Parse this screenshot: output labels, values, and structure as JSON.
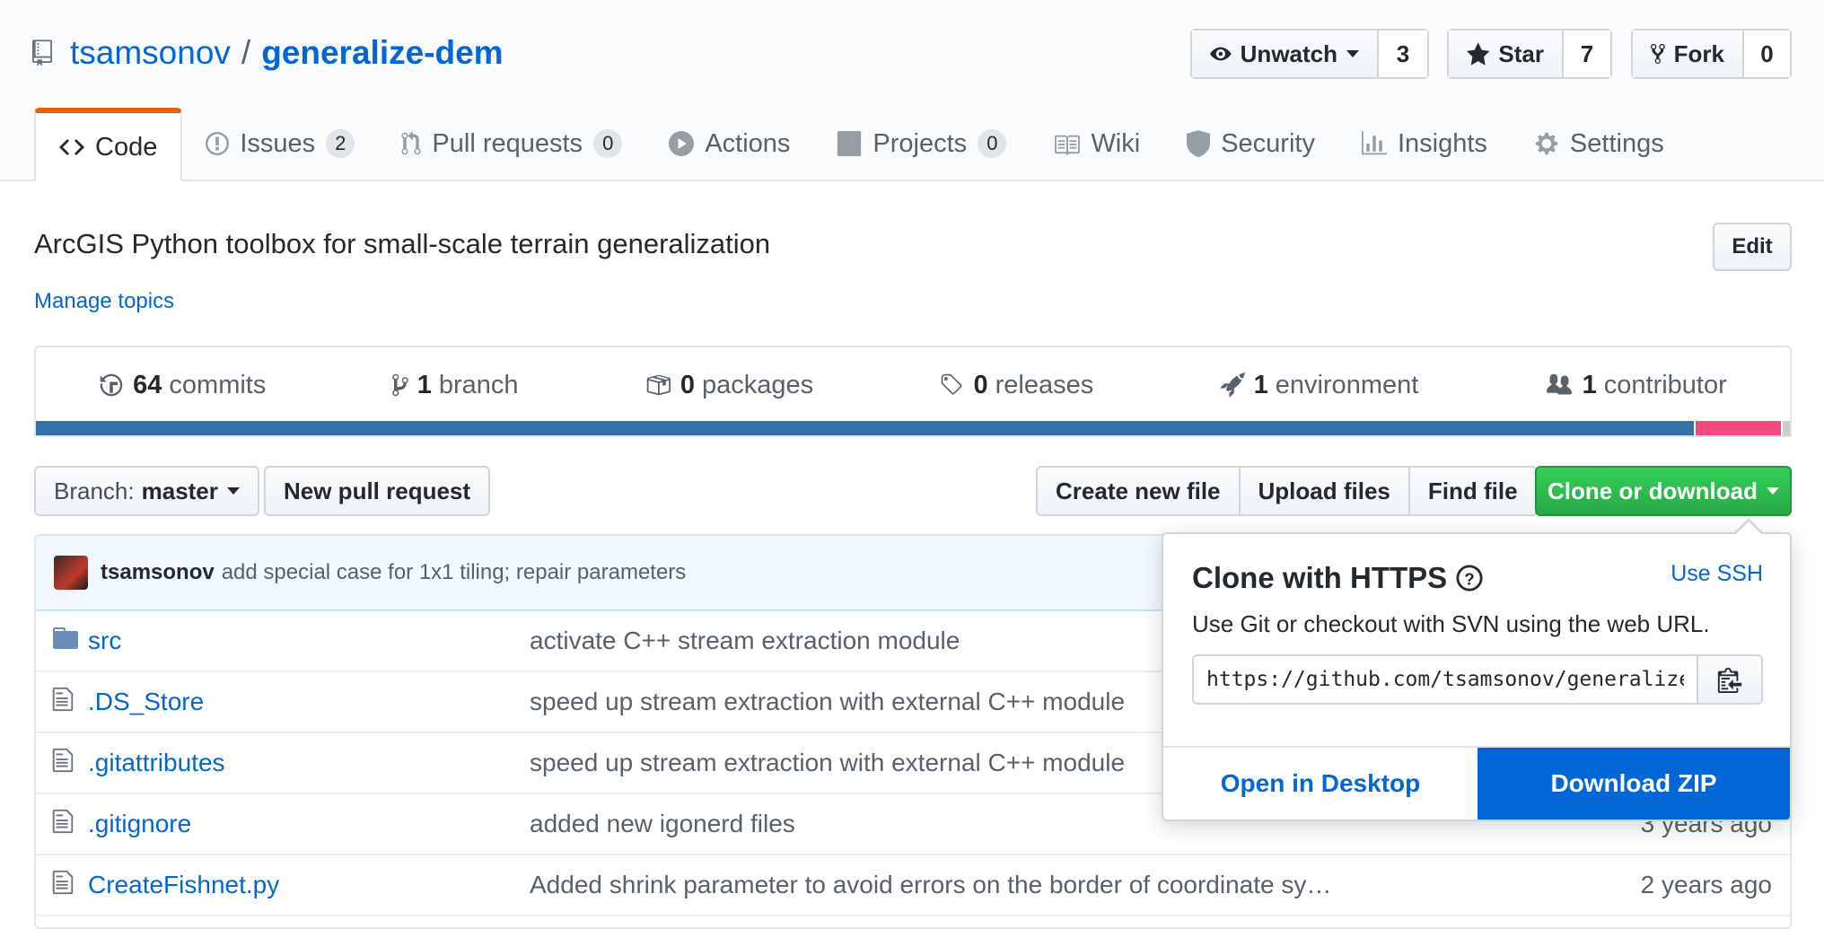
{
  "repo": {
    "owner": "tsamsonov",
    "separator": "/",
    "name": "generalize-dem"
  },
  "social": {
    "watch": {
      "label": "Unwatch",
      "count": "3"
    },
    "star": {
      "label": "Star",
      "count": "7"
    },
    "fork": {
      "label": "Fork",
      "count": "0"
    }
  },
  "tabs": [
    {
      "label": "Code",
      "icon": "code-icon"
    },
    {
      "label": "Issues",
      "count": "2",
      "icon": "issue-icon"
    },
    {
      "label": "Pull requests",
      "count": "0",
      "icon": "pull-request-icon"
    },
    {
      "label": "Actions",
      "icon": "play-icon"
    },
    {
      "label": "Projects",
      "count": "0",
      "icon": "project-icon"
    },
    {
      "label": "Wiki",
      "icon": "book-icon"
    },
    {
      "label": "Security",
      "icon": "shield-icon"
    },
    {
      "label": "Insights",
      "icon": "graph-icon"
    },
    {
      "label": "Settings",
      "icon": "gear-icon"
    }
  ],
  "description": "ArcGIS Python toolbox for small-scale terrain generalization",
  "manage_topics": "Manage topics",
  "edit_label": "Edit",
  "summary": [
    {
      "count": "64",
      "label": "commits",
      "icon": "history-icon"
    },
    {
      "count": "1",
      "label": "branch",
      "icon": "branch-icon"
    },
    {
      "count": "0",
      "label": "packages",
      "icon": "package-icon"
    },
    {
      "count": "0",
      "label": "releases",
      "icon": "tag-icon"
    },
    {
      "count": "1",
      "label": "environment",
      "icon": "rocket-icon"
    },
    {
      "count": "1",
      "label": "contributor",
      "icon": "people-icon"
    }
  ],
  "languages": [
    {
      "color": "#3572A5",
      "share": 94.5
    },
    {
      "color": "#f34b7d",
      "share": 5.0
    },
    {
      "color": "#cccccc",
      "share": 0.5
    }
  ],
  "toolbar": {
    "branch_prefix": "Branch:",
    "branch_name": "master",
    "new_pr": "New pull request",
    "create_file": "Create new file",
    "upload_files": "Upload files",
    "find_file": "Find file",
    "clone": "Clone or download"
  },
  "latest_commit": {
    "author": "tsamsonov",
    "message": "add special case for 1x1 tiling; repair parameters"
  },
  "files": [
    {
      "type": "dir",
      "name": "src",
      "message": "activate C++ stream extraction module",
      "age": ""
    },
    {
      "type": "file",
      "name": ".DS_Store",
      "message": "speed up stream extraction with external C++ module",
      "age": ""
    },
    {
      "type": "file",
      "name": ".gitattributes",
      "message": "speed up stream extraction with external C++ module",
      "age": ""
    },
    {
      "type": "file",
      "name": ".gitignore",
      "message": "added new igonerd files",
      "age": "3 years ago"
    },
    {
      "type": "file",
      "name": "CreateFishnet.py",
      "message": "Added shrink parameter to avoid errors on the border of coordinate sy…",
      "age": "2 years ago"
    }
  ],
  "clone_popover": {
    "title": "Clone with HTTPS",
    "use_ssh": "Use SSH",
    "help": "Use Git or checkout with SVN using the web URL.",
    "url": "https://github.com/tsamsonov/generalize-dem.git",
    "open_desktop": "Open in Desktop",
    "download_zip": "Download ZIP"
  }
}
